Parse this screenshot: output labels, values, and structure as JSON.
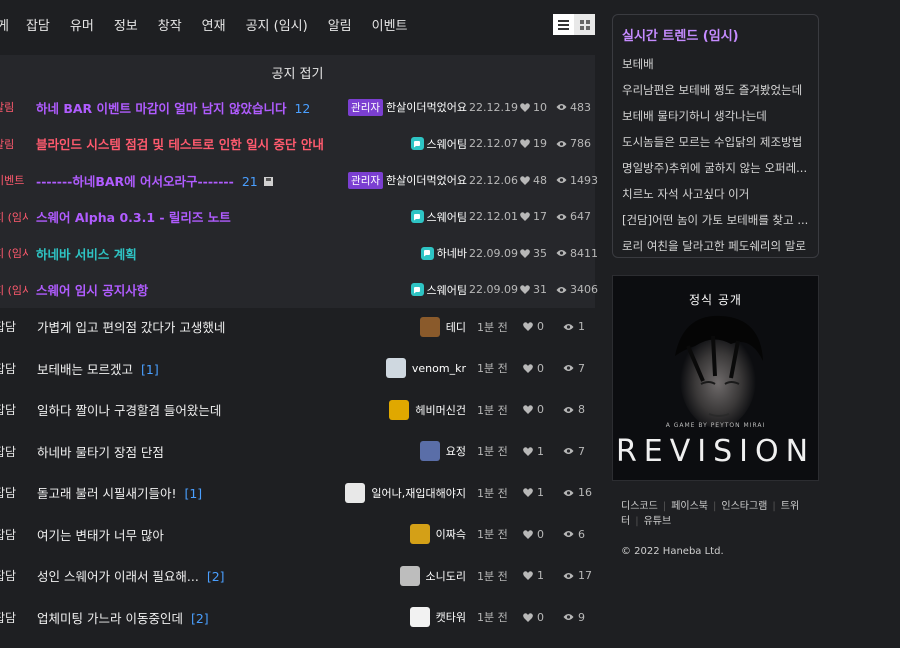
{
  "tabs": [
    "게",
    "잡담",
    "유머",
    "정보",
    "창작",
    "연재",
    "공지 (임시)",
    "알림",
    "이벤트"
  ],
  "notice_collapse": "공지 접기",
  "notices": [
    {
      "cat": "알림",
      "title": "하네 BAR 이벤트 마감이 얼마 남지 않았습니다",
      "count": "12",
      "title_color": "#b05cff",
      "admin": true,
      "admin_label": "관리자",
      "author": "한살이더먹었어요",
      "date": "22.12.19",
      "likes": "10",
      "views": "483"
    },
    {
      "cat": "알림",
      "title": "블라인드 시스템 점검 및 테스트로 인한 일시 중단 안내",
      "count": "",
      "title_color": "#ff5a6e",
      "admin": false,
      "author": "스웨어팀",
      "date": "22.12.07",
      "likes": "19",
      "views": "786"
    },
    {
      "cat": "이벤트",
      "title": "-------하네BAR에 어서오라구-------",
      "count": "21",
      "title_color": "#b05cff",
      "admin": true,
      "admin_label": "관리자",
      "author": "한살이더먹었어요",
      "date": "22.12.06",
      "likes": "48",
      "views": "1493"
    },
    {
      "cat": "지 (임시)",
      "title": "스웨어 Alpha 0.3.1 - 릴리즈 노트",
      "count": "",
      "title_color": "#b05cff",
      "admin": false,
      "author": "스웨어팀",
      "date": "22.12.01",
      "likes": "17",
      "views": "647"
    },
    {
      "cat": "지 (임시)",
      "title": "하네바 서비스 계획",
      "count": "",
      "title_color": "#2ec4c4",
      "admin": false,
      "author": "하네바",
      "date": "22.09.09",
      "likes": "35",
      "views": "8411"
    },
    {
      "cat": "지 (임시)",
      "title": "스웨어 임시 공지사항",
      "count": "",
      "title_color": "#b05cff",
      "admin": false,
      "author": "스웨어팀",
      "date": "22.09.09",
      "likes": "31",
      "views": "3406"
    }
  ],
  "posts": [
    {
      "cat": "잡담",
      "title": "가볍게 입고 편의점 갔다가 고생했네",
      "count": "",
      "author": "테디",
      "avatar_color": "#8a5a2b",
      "time": "1분 전",
      "likes": "0",
      "views": "1"
    },
    {
      "cat": "잡담",
      "title": "보테배는 모르겠고",
      "count": "[1]",
      "author": "venom_kr",
      "avatar_color": "#cfd8e0",
      "time": "1분 전",
      "likes": "0",
      "views": "7"
    },
    {
      "cat": "잡담",
      "title": "일하다 짤이나 구경할겸 들어왔는데",
      "count": "",
      "author": "헤비머신건",
      "avatar_color": "#e0a800",
      "time": "1분 전",
      "likes": "0",
      "views": "8"
    },
    {
      "cat": "잡담",
      "title": "하네바 물타기 장점 단점",
      "count": "",
      "author": "요정",
      "avatar_color": "#5a6ea8",
      "time": "1분 전",
      "likes": "1",
      "views": "7"
    },
    {
      "cat": "잡담",
      "title": "돌고래 불러 시필새기들아!",
      "count": "[1]",
      "author": "일어나,재입대해야지",
      "avatar_color": "#e8e8e8",
      "time": "1분 전",
      "likes": "1",
      "views": "16"
    },
    {
      "cat": "잡담",
      "title": "여기는 변태가 너무 많아",
      "count": "",
      "author": "이짜슥",
      "avatar_color": "#d4a017",
      "time": "1분 전",
      "likes": "0",
      "views": "6"
    },
    {
      "cat": "잡담",
      "title": "성인 스웨어가 이래서 필요해...",
      "count": "[2]",
      "author": "소니도리",
      "avatar_color": "#bdbdbd",
      "time": "1분 전",
      "likes": "1",
      "views": "17"
    },
    {
      "cat": "잡담",
      "title": "업체미팅 가느라 이동중인데",
      "count": "[2]",
      "author": "캣타워",
      "avatar_color": "#f2f2f2",
      "time": "1분 전",
      "likes": "0",
      "views": "9"
    }
  ],
  "trend": {
    "title": "실시간 트렌드 (임시)",
    "items": [
      "보테배",
      "우리남편은 보테배 쩡도 즐겨봤었는데",
      "보테배 물타기하니 생각나는데",
      "도시놈들은 모르는 수입닭의 제조방법",
      "명일방주)추위에 굴하지 않는 오퍼레...",
      "치르노 자석 사고싶다 이거",
      "[건담]어떤 놈이 가토 보테배를 찾고 ...",
      "로리 여친을 달라고한 페도쉐리의 말로"
    ]
  },
  "banner": {
    "label": "정식 공개",
    "sub": "A GAME BY PEYTON MIRAI",
    "logo": "REVISION"
  },
  "footer": {
    "links": [
      "디스코드",
      "페이스북",
      "인스타그램",
      "트위터",
      "유튜브"
    ],
    "copyright": "© 2022 Haneba Ltd."
  }
}
